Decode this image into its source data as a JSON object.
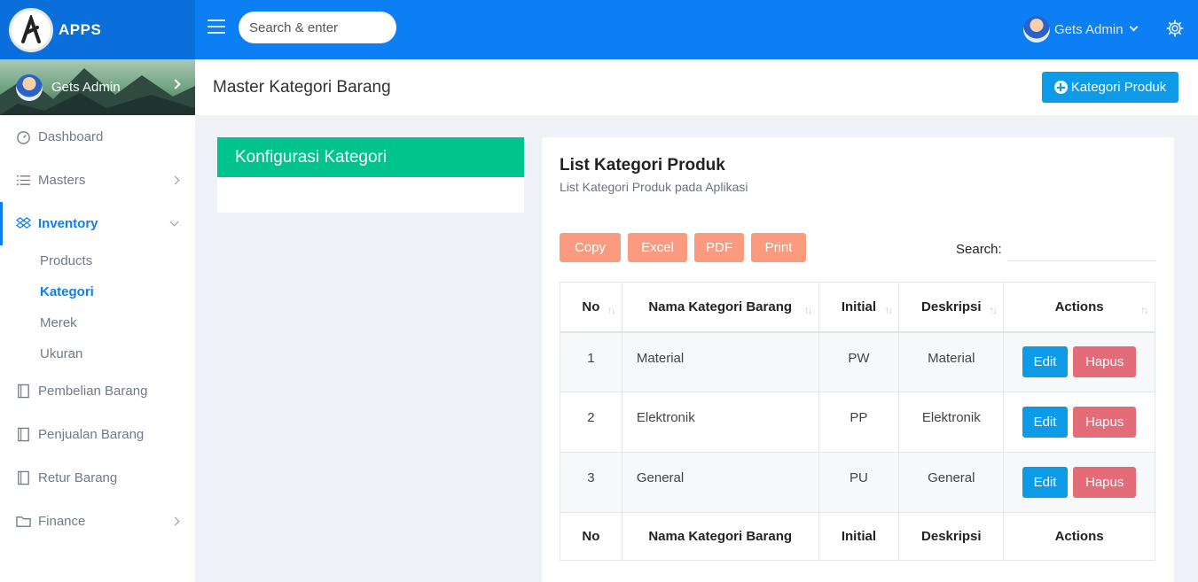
{
  "brand": {
    "name": "APPS"
  },
  "topbar": {
    "search_placeholder": "Search & enter",
    "user_name": "Gets Admin"
  },
  "sidebar": {
    "profile_name": "Gets Admin",
    "items": [
      {
        "label": "Dashboard",
        "icon": "dashboard-icon"
      },
      {
        "label": "Masters",
        "icon": "list-icon"
      },
      {
        "label": "Inventory",
        "icon": "dropbox-icon",
        "active": true
      },
      {
        "label": "Pembelian Barang",
        "icon": "clipboard-icon"
      },
      {
        "label": "Penjualan Barang",
        "icon": "clipboard-icon"
      },
      {
        "label": "Retur Barang",
        "icon": "clipboard-icon"
      },
      {
        "label": "Finance",
        "icon": "folder-icon"
      }
    ],
    "inventory_sub": [
      "Products",
      "Kategori",
      "Merek",
      "Ukuran"
    ]
  },
  "page": {
    "title": "Master Kategori Barang",
    "add_button": "Kategori Produk"
  },
  "left_card": {
    "title": "Konfigurasi Kategori"
  },
  "right_card": {
    "title": "List Kategori Produk",
    "subtitle": "List Kategori Produk pada Aplikasi",
    "tools": [
      "Copy",
      "Excel",
      "PDF",
      "Print"
    ],
    "search_label": "Search:",
    "columns": [
      "No",
      "Nama Kategori Barang",
      "Initial",
      "Deskripsi",
      "Actions"
    ],
    "rows": [
      {
        "no": "1",
        "nama": "Material",
        "initial": "PW",
        "deskripsi": "Material"
      },
      {
        "no": "2",
        "nama": "Elektronik",
        "initial": "PP",
        "deskripsi": "Elektronik"
      },
      {
        "no": "3",
        "nama": "General",
        "initial": "PU",
        "deskripsi": "General"
      }
    ],
    "edit_label": "Edit",
    "delete_label": "Hapus"
  },
  "colors": {
    "primary": "#0d7ff4",
    "green": "#00c38d",
    "tool_button": "#fa9a7e",
    "delete": "#e46b78",
    "edit": "#0d9be8"
  }
}
